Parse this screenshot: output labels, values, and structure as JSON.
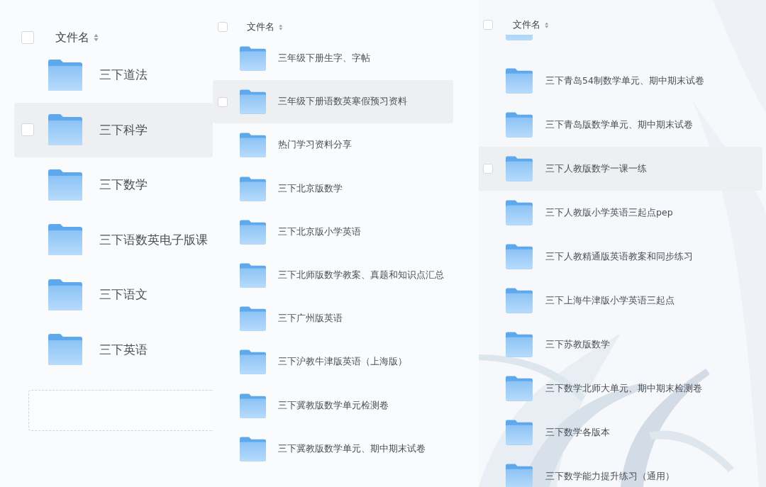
{
  "panels": [
    {
      "header": {
        "label": "文件名",
        "checked": false
      },
      "rows": [
        {
          "kind": "folder",
          "name": "三下道法",
          "highlighted": false
        },
        {
          "kind": "folder",
          "name": "三下科学",
          "highlighted": true,
          "checked": false
        },
        {
          "kind": "folder",
          "name": "三下数学",
          "highlighted": false
        },
        {
          "kind": "folder",
          "name": "三下语数英电子版课",
          "highlighted": false
        },
        {
          "kind": "folder",
          "name": "三下语文",
          "highlighted": false
        },
        {
          "kind": "folder",
          "name": "三下英语",
          "highlighted": false
        },
        {
          "kind": "dropzone"
        }
      ]
    },
    {
      "header": {
        "label": "文件名",
        "checked": false
      },
      "rows": [
        {
          "kind": "folder",
          "name": "三年级下册生字、字帖",
          "highlighted": false
        },
        {
          "kind": "folder",
          "name": "三年级下册语数英寒假预习资料",
          "highlighted": true,
          "checked": false
        },
        {
          "kind": "folder",
          "name": "热门学习资料分享",
          "highlighted": false
        },
        {
          "kind": "folder",
          "name": "三下北京版数学",
          "highlighted": false
        },
        {
          "kind": "folder",
          "name": "三下北京版小学英语",
          "highlighted": false
        },
        {
          "kind": "folder",
          "name": "三下北师版数学教案、真题和知识点汇总",
          "highlighted": false
        },
        {
          "kind": "folder",
          "name": "三下广州版英语",
          "highlighted": false
        },
        {
          "kind": "folder",
          "name": "三下沪教牛津版英语（上海版）",
          "highlighted": false
        },
        {
          "kind": "folder",
          "name": "三下冀教版数学单元检测卷",
          "highlighted": false
        },
        {
          "kind": "folder",
          "name": "三下冀教版数学单元、期中期末试卷",
          "highlighted": false
        }
      ]
    },
    {
      "header": {
        "label": "文件名",
        "checked": false
      },
      "rows": [
        {
          "kind": "cut"
        },
        {
          "kind": "folder",
          "name": "三下青岛54制数学单元、期中期末试卷",
          "highlighted": false
        },
        {
          "kind": "folder",
          "name": "三下青岛版数学单元、期中期末试卷",
          "highlighted": false
        },
        {
          "kind": "folder",
          "name": "三下人教版数学一课一练",
          "highlighted": true,
          "checked": false
        },
        {
          "kind": "folder",
          "name": "三下人教版小学英语三起点pep",
          "highlighted": false
        },
        {
          "kind": "folder",
          "name": "三下人教精通版英语教案和同步练习",
          "highlighted": false
        },
        {
          "kind": "folder",
          "name": "三下上海牛津版小学英语三起点",
          "highlighted": false
        },
        {
          "kind": "folder",
          "name": "三下苏教版数学",
          "highlighted": false
        },
        {
          "kind": "folder",
          "name": "三下数学北师大单元、期中期末检测卷",
          "highlighted": false
        },
        {
          "kind": "folder",
          "name": "三下数学各版本",
          "highlighted": false
        },
        {
          "kind": "folder",
          "name": "三下数学能力提升练习（通用）",
          "highlighted": false
        }
      ]
    }
  ]
}
